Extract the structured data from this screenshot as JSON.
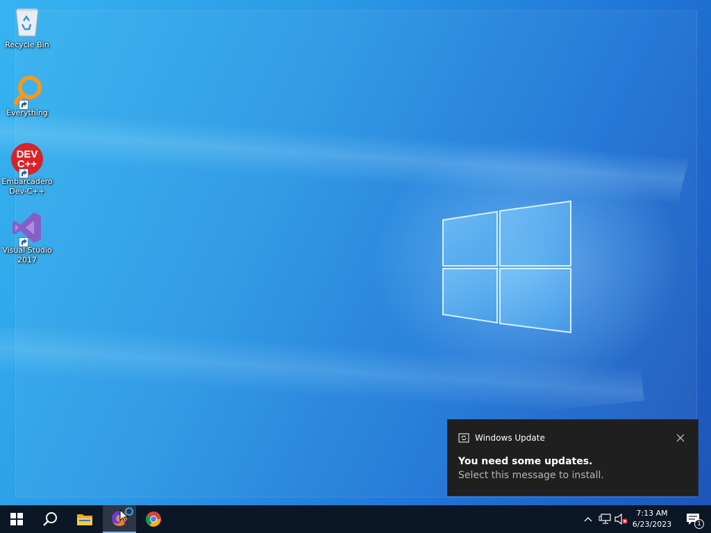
{
  "desktop": {
    "icons": [
      {
        "label": "Recycle Bin",
        "icon": "recycle-bin-icon"
      },
      {
        "label": "Everything",
        "icon": "everything-search-icon"
      },
      {
        "label": "Embarcadero Dev-C++",
        "icon": "dev-cpp-icon",
        "logo_text": "DEV C++"
      },
      {
        "label": "Visual Studio 2017",
        "icon": "visual-studio-icon"
      }
    ]
  },
  "toast": {
    "app_name": "Windows Update",
    "title": "You need some updates.",
    "body": "Select this message to install."
  },
  "taskbar": {
    "pinned": [
      {
        "name": "start-button",
        "icon": "windows-start-icon"
      },
      {
        "name": "search-button",
        "icon": "search-icon"
      },
      {
        "name": "file-explorer-button",
        "icon": "folder-icon"
      },
      {
        "name": "firefox-button",
        "icon": "firefox-icon",
        "active": true
      },
      {
        "name": "chrome-button",
        "icon": "chrome-icon"
      }
    ],
    "tray": {
      "icons": [
        "chevron-up-icon",
        "network-icon",
        "volume-muted-icon"
      ],
      "time": "7:13 AM",
      "date": "6/23/2023",
      "notification_count": "1"
    }
  },
  "colors": {
    "taskbar_bg": "#0b1726",
    "toast_bg": "#1f1f1f",
    "accent": "#0078d7"
  }
}
